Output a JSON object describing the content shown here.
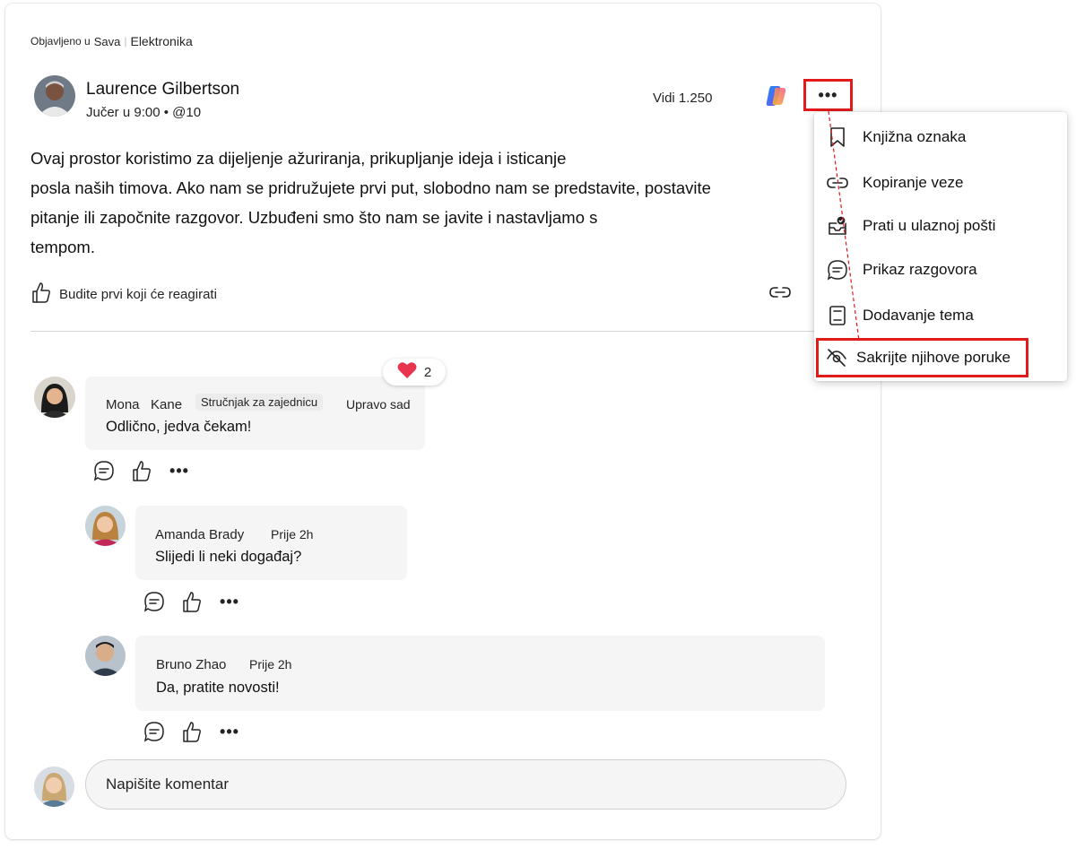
{
  "breadcrumb": {
    "prefix": "Objavljeno u",
    "community": "Sava",
    "group": "Elektronika"
  },
  "post": {
    "author": "Laurence Gilbertson",
    "meta": "Jučer u 9:00 • @10",
    "views": "Vidi 1.250",
    "body_lines": [
      "Ovaj prostor koristimo za dijeljenje ažuriranja, prikupljanje ideja i isticanje",
      "posla naših timova. Ako nam se pridružujete prvi put, slobodno nam se predstavite, postavite",
      "pitanje ili započnite razgovor. Uzbuđeni smo što nam se javite i nastavljamo s",
      "tempom."
    ],
    "react_prompt": "Budite prvi koji će reagirati"
  },
  "comments": [
    {
      "first_name": "Mona",
      "last_name": "Kane",
      "badge": "Stručnjak za zajednicu",
      "time": "Upravo sad",
      "text": "Odlično, jedva čekam!",
      "reaction_count": "2"
    },
    {
      "name": "Amanda Brady",
      "time": "Prije 2h",
      "text": "Slijedi li neki događaj?"
    },
    {
      "name": "Bruno Zhao",
      "time": "Prije 2h",
      "text": "Da, pratite novosti!"
    }
  ],
  "composer": {
    "placeholder": "Napišite komentar"
  },
  "menu": {
    "items": [
      {
        "label": "Knjižna oznaka",
        "icon": "bookmark-icon"
      },
      {
        "label": "Kopiranje veze",
        "icon": "link-icon"
      },
      {
        "label": "Prati u ulaznoj pošti",
        "icon": "inbox-follow-icon"
      },
      {
        "label": "Prikaz razgovora",
        "icon": "conversation-icon"
      },
      {
        "label": "Dodavanje tema",
        "icon": "topic-icon"
      },
      {
        "label": "Sakrijte njihove poruke",
        "icon": "eye-off-icon"
      }
    ]
  },
  "colors": {
    "highlight": "#e21a1a",
    "heart": "#e8344e",
    "comment_bg": "#f5f5f5"
  }
}
